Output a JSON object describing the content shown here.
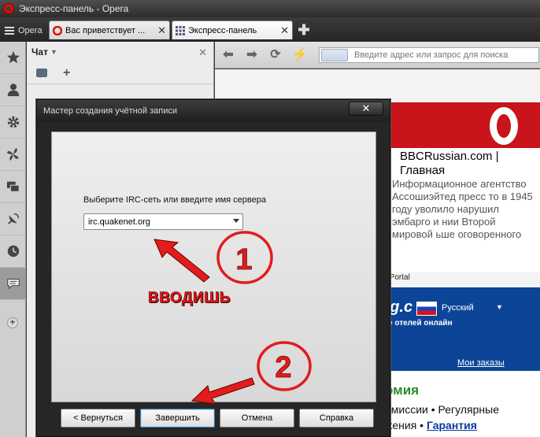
{
  "window": {
    "title": "Экспресс-панель - Opera"
  },
  "menu": {
    "label": "Opera"
  },
  "tabs": [
    {
      "label": "Вас приветствует ..."
    },
    {
      "label": "Экспресс-панель"
    }
  ],
  "sidebar": {
    "icons": [
      "star-icon",
      "person-icon",
      "gear-icon",
      "fan-icon",
      "windows-icon",
      "satellite-icon",
      "clock-icon",
      "chat-icon"
    ],
    "active": "chat-icon"
  },
  "chat_panel": {
    "title": "Чат"
  },
  "address_bar": {
    "placeholder": "Введите адрес или запрос для поиска"
  },
  "speed_dial": {
    "card1": {
      "title": "BBCRussian.com | Главная",
      "text": "Информационное агентство Ассошиэйтед пресс то в 1945 году уволило нарушил эмбарго и нии Второй мировой ьше оговоренного",
      "caption": "ra Portal"
    },
    "card2": {
      "logo": "ng.c",
      "lang": "Русский",
      "sub": "е отелей онлайн",
      "link": "Мои заказы"
    },
    "card3": {
      "title": "омия",
      "line1": "омиссии • Регулярные",
      "line2_prefix": "жения • ",
      "line2_link": "Гарантия"
    }
  },
  "dialog": {
    "title": "Мастер создания учётной записи",
    "label": "Выберите IRC-сеть или введите имя сервера",
    "server_value": "irc.quakenet.org",
    "buttons": {
      "back": "< Вернуться",
      "finish": "Завершить",
      "cancel": "Отмена",
      "help": "Справка"
    }
  },
  "annotations": {
    "caption": "ВВОДИШЬ",
    "step1": "1",
    "step2": "2",
    "color": "#e21c1c"
  }
}
